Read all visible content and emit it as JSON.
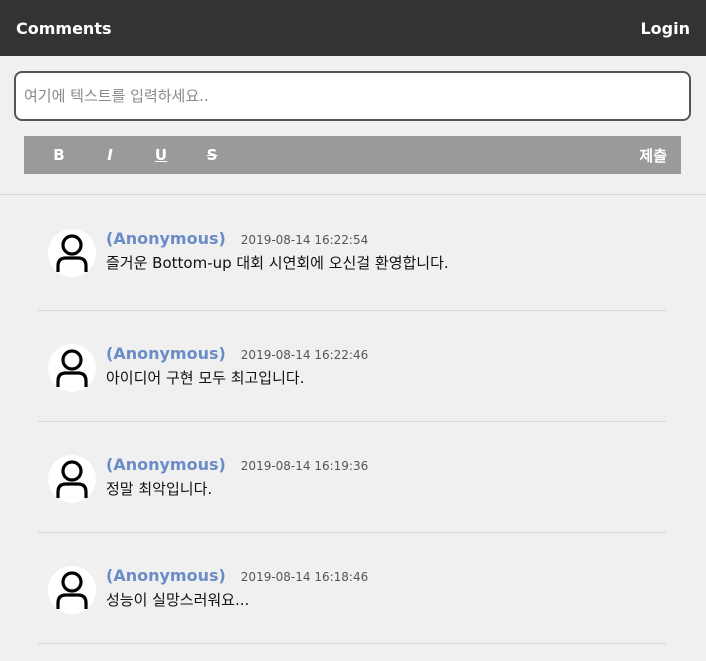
{
  "header": {
    "title": "Comments",
    "login_label": "Login"
  },
  "composer": {
    "placeholder": "여기에 텍스트를 입력하세요..",
    "format_buttons": [
      "B",
      "I",
      "U",
      "S"
    ],
    "submit_label": "제출"
  },
  "colors": {
    "topbar": "#333333",
    "toolbar": "#9a9a9a",
    "author": "#6a8cc7",
    "background": "#f0f0f0"
  },
  "comments": [
    {
      "author": "(Anonymous)",
      "time": "2019-08-14 16:22:54",
      "text": "즐거운 Bottom-up 대회 시연회에 오신걸 환영합니다.",
      "avatar_icon": "user-avatar-icon"
    },
    {
      "author": "(Anonymous)",
      "time": "2019-08-14 16:22:46",
      "text": "아이디어 구현 모두 최고입니다.",
      "avatar_icon": "user-avatar-icon"
    },
    {
      "author": "(Anonymous)",
      "time": "2019-08-14 16:19:36",
      "text": "정말 최악입니다.",
      "avatar_icon": "user-avatar-icon"
    },
    {
      "author": "(Anonymous)",
      "time": "2019-08-14 16:18:46",
      "text": "성능이 실망스러워요...",
      "avatar_icon": "user-avatar-icon"
    }
  ]
}
